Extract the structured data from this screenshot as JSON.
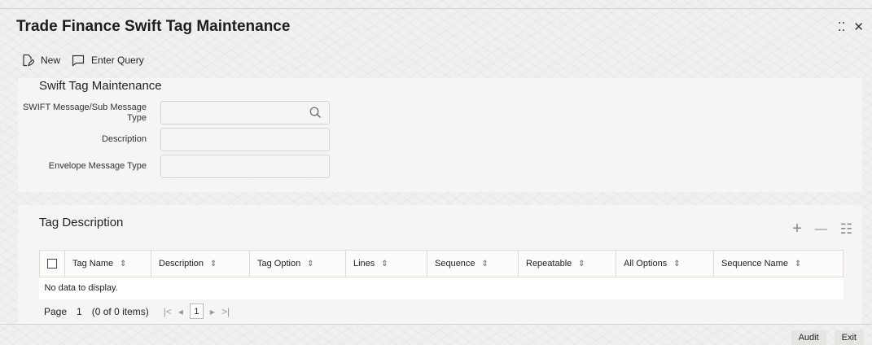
{
  "window": {
    "title": "Trade Finance Swift Tag Maintenance",
    "restore_glyph": "⁚⁚",
    "close_glyph": "✕"
  },
  "toolbar": {
    "new_label": "New",
    "enter_query_label": "Enter Query"
  },
  "swift_section": {
    "title": "Swift Tag Maintenance",
    "fields": [
      {
        "label": "SWIFT Message/Sub Message Type",
        "value": ""
      },
      {
        "label": "Description",
        "value": ""
      },
      {
        "label": "Envelope Message Type",
        "value": ""
      }
    ]
  },
  "tag_section": {
    "title": "Tag Description",
    "tools": {
      "add": "+",
      "remove": "—",
      "view": "☷"
    },
    "columns": [
      "Tag Name",
      "Description",
      "Tag Option",
      "Lines",
      "Sequence",
      "Repeatable",
      "All Options",
      "Sequence Name"
    ],
    "empty_message": "No data to display.",
    "pager": {
      "page_label": "Page",
      "page_value": "1",
      "items_info": "(0 of 0 items)",
      "first": "|<",
      "prev": "◂",
      "current": "1",
      "next": "▸",
      "last": ">|"
    }
  },
  "footer": {
    "audit_label": "Audit",
    "exit_label": "Exit"
  },
  "colors": {
    "background": "#f1f0ee",
    "panel": "#f6f5f3",
    "border": "#d6d4d0"
  }
}
